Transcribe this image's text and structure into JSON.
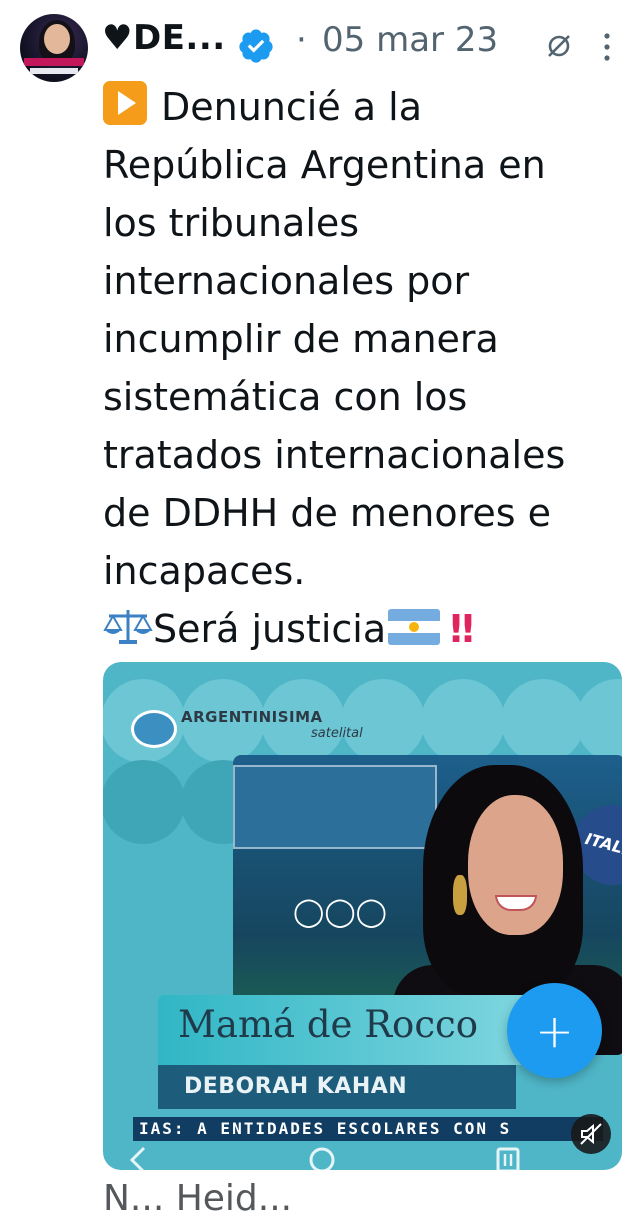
{
  "header": {
    "display_name": "♥DE...",
    "separator": "·",
    "date": "05 mar 23"
  },
  "tweet": {
    "lines": [
      "Denuncié a la",
      "República Argentina en",
      "los tribunales",
      "internacionales por",
      "incumplir de manera",
      "sistemática con los",
      "tratados internacionales",
      "de DDHH de menores e",
      "incapaces."
    ],
    "closing": "Será justicia",
    "closing_marks": "‼"
  },
  "media": {
    "channel_name": "ARGENTINISIMA",
    "channel_sub": "satelital",
    "jersey_text": "ITALIA",
    "caption_title": "Mamá de Rocco",
    "caption_name": "DEBORAH KAHAN",
    "ticker": "IAS: A ENTIDADES ESCOLARES CON S"
  },
  "fab": {
    "label": "+"
  },
  "next_tweet": {
    "partial_text": "N... Heid..."
  },
  "colors": {
    "accent": "#1d9bf0",
    "text": "#0f1419",
    "secondary": "#536471",
    "media_bg": "#4fb6c8"
  }
}
